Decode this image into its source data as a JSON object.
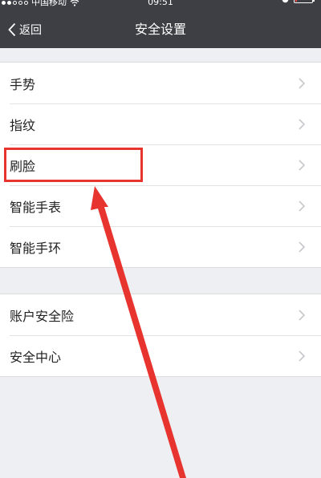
{
  "status_bar": {
    "carrier": "中国移动",
    "time": "09:51",
    "signal_bars_filled": 2,
    "battery_fraction": 0.12
  },
  "nav": {
    "back_label": "返回",
    "title": "安全设置"
  },
  "groups": [
    {
      "items": [
        {
          "label": "手势"
        },
        {
          "label": "指纹"
        },
        {
          "label": "刷脸"
        },
        {
          "label": "智能手表"
        },
        {
          "label": "智能手环"
        }
      ]
    },
    {
      "items": [
        {
          "label": "账户安全险"
        },
        {
          "label": "安全中心"
        }
      ]
    }
  ],
  "annotation": {
    "highlighted_item": "刷脸",
    "color": "#e8342f"
  },
  "colors": {
    "navbar": "#3e3f44",
    "page_background": "#eeeff3",
    "chevron": "#c7c7cc"
  }
}
